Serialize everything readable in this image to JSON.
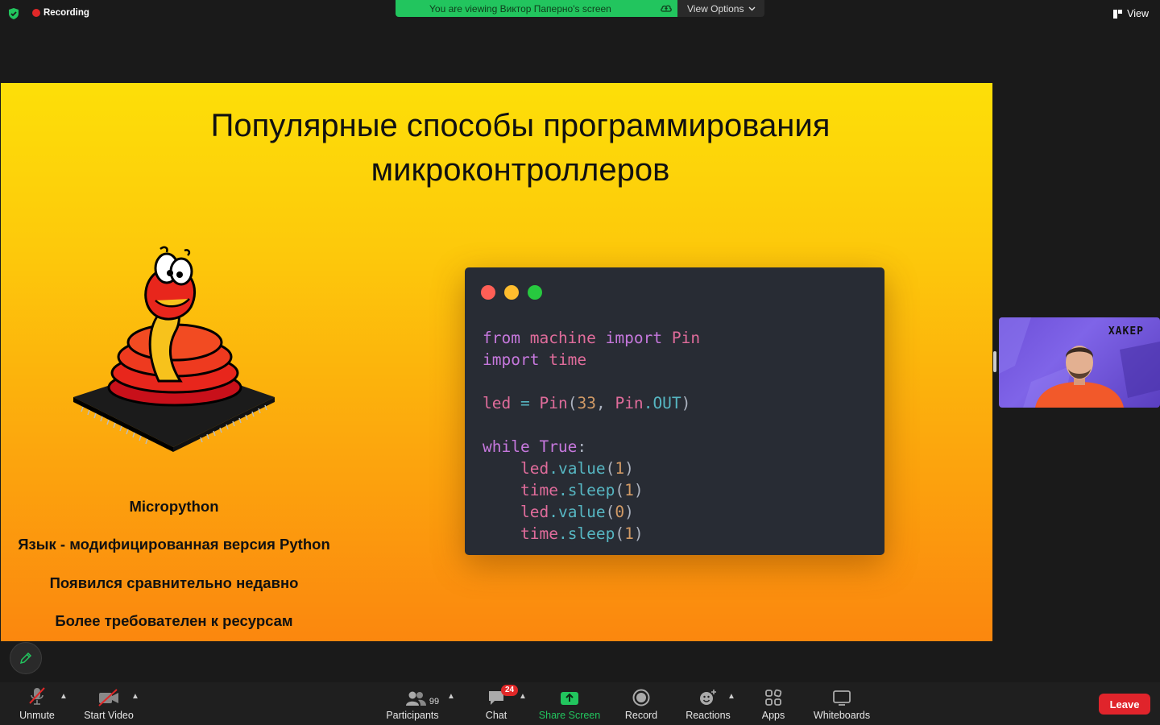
{
  "topbar": {
    "recording_label": "Recording",
    "viewing_banner": "You are viewing Виктор Паперно's screen",
    "view_options_label": "View Options",
    "view_label": "View"
  },
  "slide": {
    "title_line1": "Популярные способы программирования",
    "title_line2": "микроконтроллеров",
    "bullets": [
      "Micropython",
      "Язык - модифицированная версия Python",
      "Появился сравнительно недавно",
      "Более требователен к ресурсам"
    ],
    "code_lines": [
      "from machine import Pin",
      "import time",
      "",
      "led = Pin(33, Pin.OUT)",
      "",
      "while True:",
      "    led.value(1)",
      "    time.sleep(1)",
      "    led.value(0)",
      "    time.sleep(1)"
    ]
  },
  "thumbnail": {
    "logo_text": "ХАКЕР"
  },
  "toolbar": {
    "unmute": "Unmute",
    "start_video": "Start Video",
    "participants": "Participants",
    "participants_count": "99",
    "chat": "Chat",
    "chat_badge": "24",
    "share_screen": "Share Screen",
    "record": "Record",
    "reactions": "Reactions",
    "apps": "Apps",
    "whiteboards": "Whiteboards",
    "leave": "Leave"
  },
  "colors": {
    "accent_green": "#22c55e",
    "leave_red": "#e0242b",
    "slide_top": "#fddf08",
    "slide_bottom": "#fb870e",
    "code_bg": "#282c34"
  }
}
